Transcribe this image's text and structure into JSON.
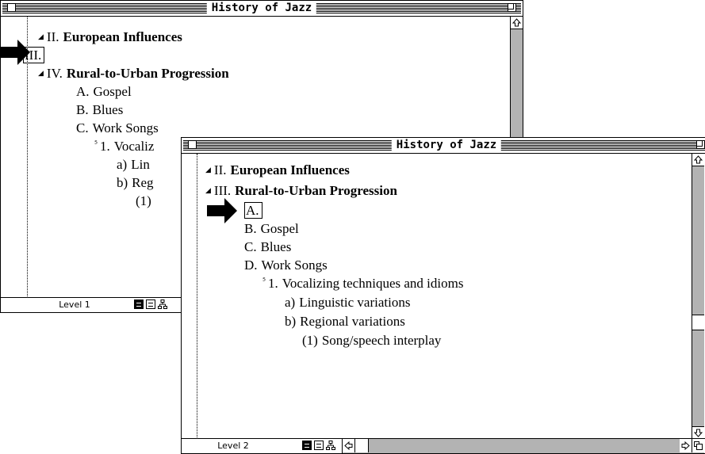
{
  "window1": {
    "title": "History of Jazz",
    "rows": [
      {
        "num": "II.",
        "text": "European Influences",
        "bold": true
      },
      {
        "num": "III.",
        "text": "",
        "selected": true
      },
      {
        "num": "IV.",
        "text": "Rural-to-Urban Progression",
        "bold": true
      },
      {
        "num": "A.",
        "text": "Gospel"
      },
      {
        "num": "B.",
        "text": "Blues"
      },
      {
        "num": "C.",
        "text": "Work Songs"
      },
      {
        "num": "1.",
        "text": "Vocaliz"
      },
      {
        "num": "a)",
        "text": "Lin"
      },
      {
        "num": "b)",
        "text": "Reg"
      },
      {
        "num": "(1)",
        "text": ""
      }
    ],
    "level_label": "Level 1"
  },
  "window2": {
    "title": "History of Jazz",
    "rows": [
      {
        "num": "II.",
        "text": "European Influences",
        "bold": true
      },
      {
        "num": "III.",
        "text": "Rural-to-Urban Progression",
        "bold": true
      },
      {
        "num": "A.",
        "text": "",
        "selected": true
      },
      {
        "num": "B.",
        "text": "Gospel"
      },
      {
        "num": "C.",
        "text": "Blues"
      },
      {
        "num": "D.",
        "text": "Work Songs"
      },
      {
        "num": "1.",
        "text": "Vocalizing techniques and idioms"
      },
      {
        "num": "a)",
        "text": "Linguistic variations"
      },
      {
        "num": "b)",
        "text": "Regional variations"
      },
      {
        "num": "(1)",
        "text": "Song/speech interplay"
      }
    ],
    "level_label": "Level 2"
  },
  "icons": {
    "pointer": "arrow-pointer-icon",
    "collapse_marker": "triangle-marker-icon",
    "expand_marker": "collapsed-marker-icon"
  }
}
